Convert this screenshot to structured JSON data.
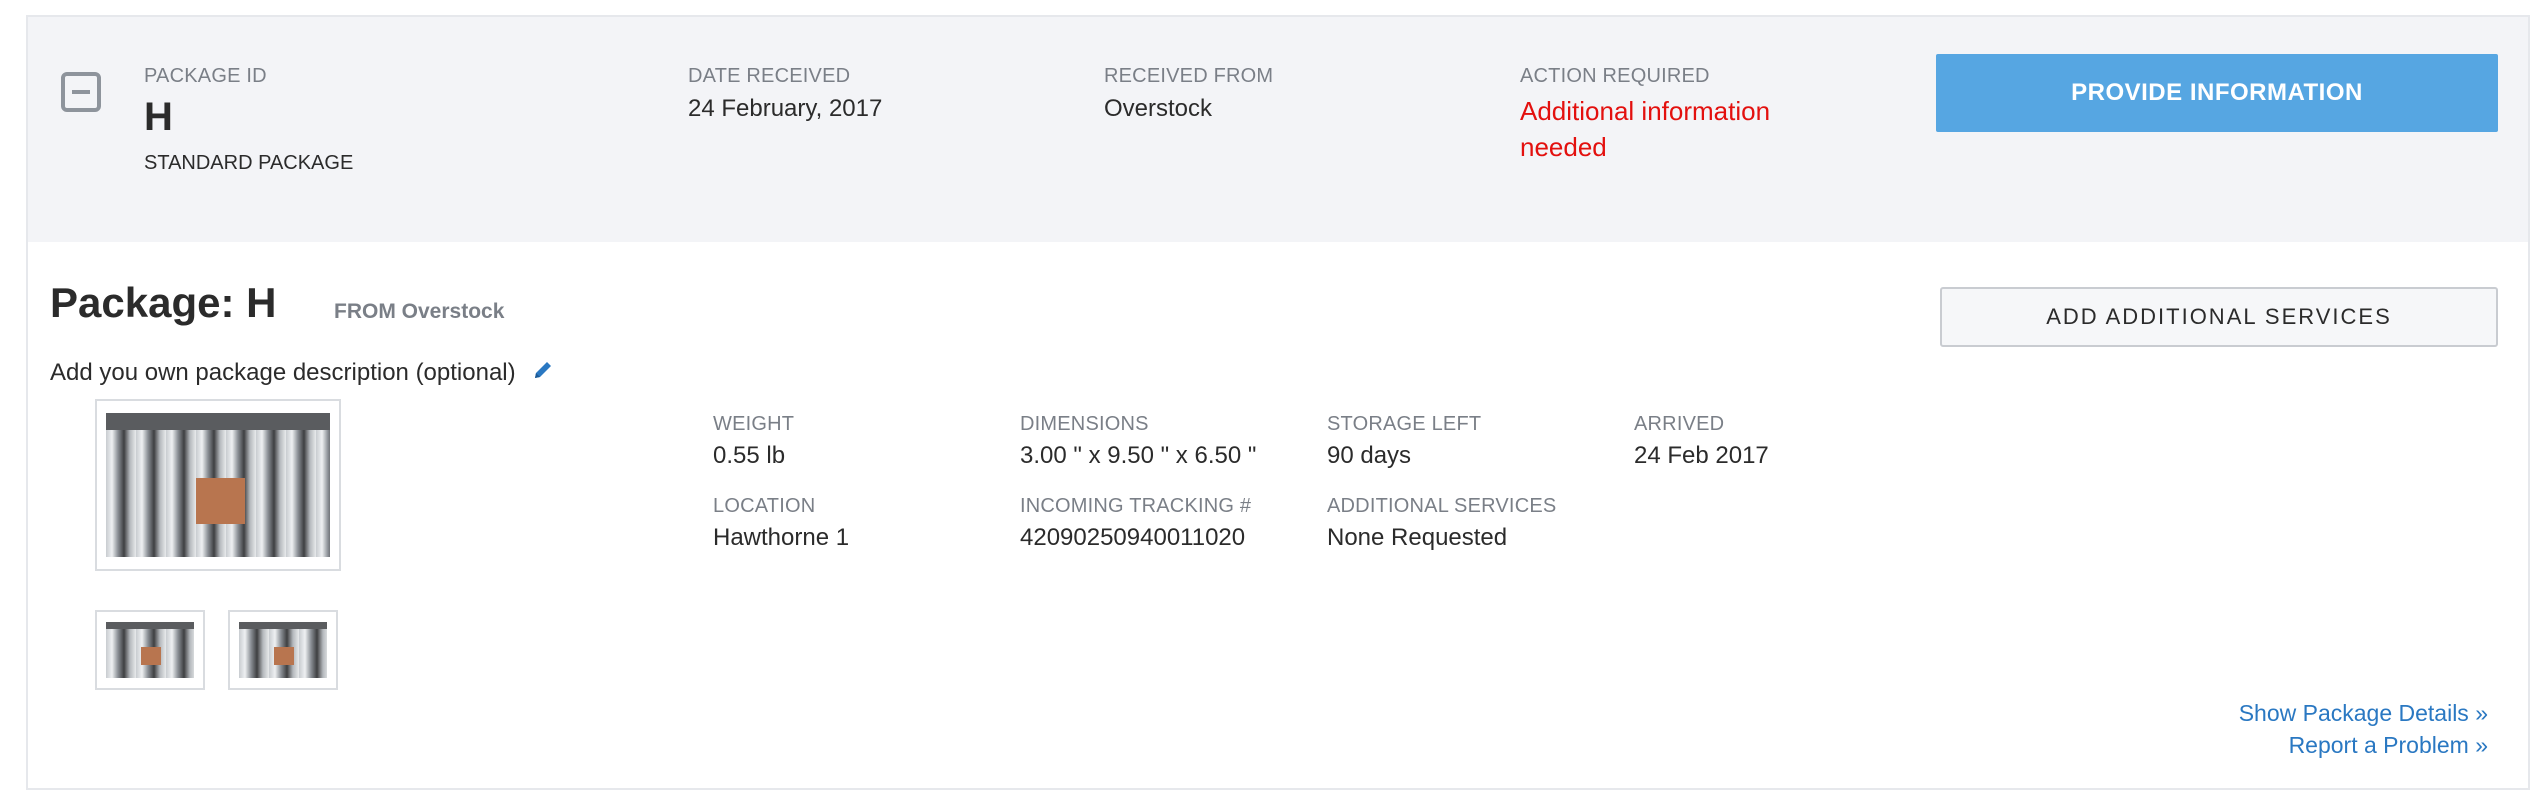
{
  "summary": {
    "package_id_label": "PACKAGE ID",
    "package_id": "H",
    "package_type": "STANDARD PACKAGE",
    "date_received_label": "DATE RECEIVED",
    "date_received": "24 February, 2017",
    "received_from_label": "RECEIVED FROM",
    "received_from": "Overstock",
    "action_required_label": "ACTION REQUIRED",
    "action_required": "Additional information needed",
    "provide_info_button": "PROVIDE INFORMATION"
  },
  "detail": {
    "title": "Package: H",
    "from": "FROM Overstock",
    "add_services_button": "ADD ADDITIONAL SERVICES",
    "description_prompt": "Add you own package description (optional)",
    "fields": {
      "weight_label": "WEIGHT",
      "weight": "0.55 lb",
      "dimensions_label": "DIMENSIONS",
      "dimensions": "3.00 \" x 9.50 \" x 6.50 \"",
      "storage_left_label": "STORAGE LEFT",
      "storage_left": "90 days",
      "arrived_label": "ARRIVED",
      "arrived": "24 Feb 2017",
      "location_label": "LOCATION",
      "location": "Hawthorne 1",
      "tracking_label": "INCOMING TRACKING #",
      "tracking": "42090250940011020",
      "additional_services_label": "ADDITIONAL SERVICES",
      "additional_services": "None Requested"
    },
    "links": {
      "show_details": "Show Package Details »",
      "report_problem": "Report a Problem »"
    }
  },
  "colors": {
    "accent": "#56a6e2",
    "alert": "#e3100e",
    "link": "#2a78c2",
    "summary_bg": "#f3f4f7"
  },
  "icons": {
    "collapse": "minus-square-icon",
    "edit": "pencil-icon"
  }
}
